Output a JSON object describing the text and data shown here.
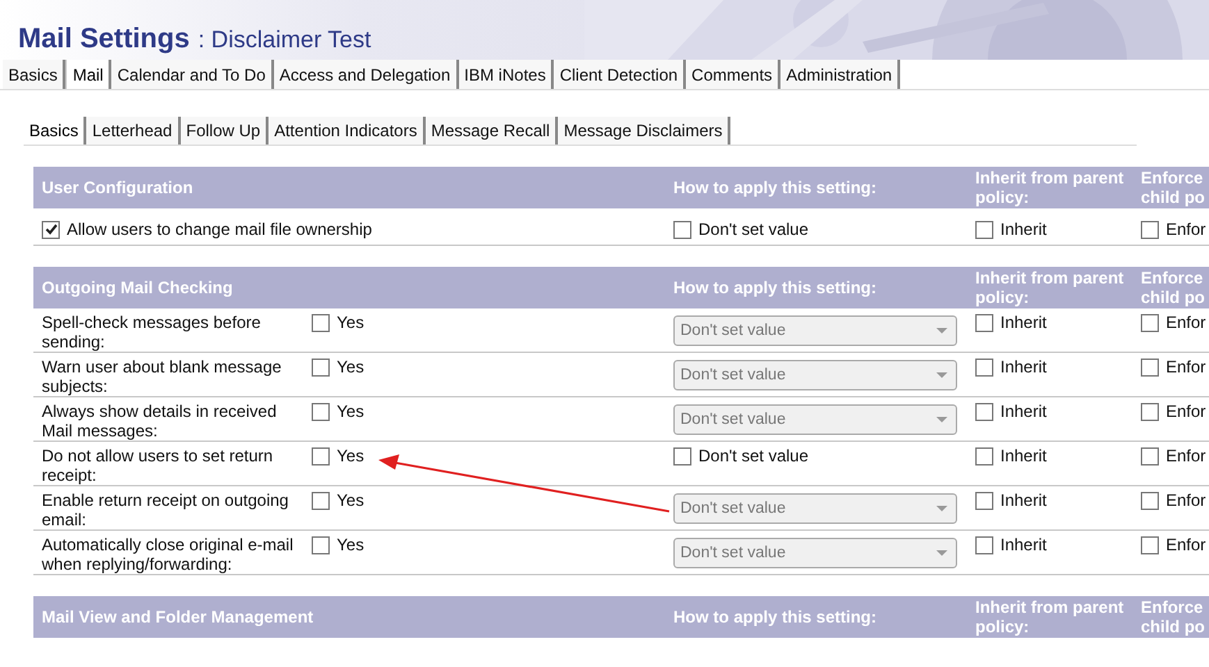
{
  "window": {
    "title": "Mail Settings",
    "subtitle": ": Disclaimer Test"
  },
  "tabs": [
    {
      "label": "Basics",
      "selected": false
    },
    {
      "label": "Mail",
      "selected": true
    },
    {
      "label": "Calendar and To Do",
      "selected": false
    },
    {
      "label": "Access and Delegation",
      "selected": false
    },
    {
      "label": "IBM iNotes",
      "selected": false
    },
    {
      "label": "Client Detection",
      "selected": false
    },
    {
      "label": "Comments",
      "selected": false
    },
    {
      "label": "Administration",
      "selected": false
    }
  ],
  "subtabs": [
    {
      "label": "Basics",
      "selected": true
    },
    {
      "label": "Letterhead",
      "selected": false
    },
    {
      "label": "Follow Up",
      "selected": false
    },
    {
      "label": "Attention Indicators",
      "selected": false
    },
    {
      "label": "Message Recall",
      "selected": false
    },
    {
      "label": "Message Disclaimers",
      "selected": false
    }
  ],
  "sections": [
    {
      "title": "User Configuration",
      "apply_header": "How to apply this setting:",
      "inherit_header": "Inherit from parent policy:",
      "enforce_header": "Enforce child po",
      "rows": [
        {
          "kind": "wide",
          "label": "Allow users to change mail file ownership",
          "checked": true,
          "apply": {
            "kind": "checkbox",
            "text": "Don't set value",
            "checked": false
          },
          "inherit": {
            "text": "Inherit",
            "checked": false
          },
          "enforce": {
            "text": "Enfor",
            "checked": false
          }
        }
      ]
    },
    {
      "title": "Outgoing Mail Checking",
      "apply_header": "How to apply this setting:",
      "inherit_header": "Inherit from parent policy:",
      "enforce_header": "Enforce child po",
      "rows": [
        {
          "kind": "yes",
          "label": "Spell-check messages before sending:",
          "value": "Yes",
          "checked": false,
          "apply": {
            "kind": "select",
            "text": "Don't set value",
            "disabled": true
          },
          "inherit": {
            "text": "Inherit",
            "checked": false
          },
          "enforce": {
            "text": "Enfor",
            "checked": false
          }
        },
        {
          "kind": "yes",
          "label": "Warn user about blank message subjects:",
          "value": "Yes",
          "checked": false,
          "apply": {
            "kind": "select",
            "text": "Don't set value",
            "disabled": true
          },
          "inherit": {
            "text": "Inherit",
            "checked": false
          },
          "enforce": {
            "text": "Enfor",
            "checked": false
          }
        },
        {
          "kind": "yes",
          "label": "Always show details in received Mail messages:",
          "value": "Yes",
          "checked": false,
          "apply": {
            "kind": "select",
            "text": "Don't set value",
            "disabled": true
          },
          "inherit": {
            "text": "Inherit",
            "checked": false
          },
          "enforce": {
            "text": "Enfor",
            "checked": false
          }
        },
        {
          "kind": "yes",
          "label": "Do not allow users to set return receipt:",
          "value": "Yes",
          "checked": false,
          "apply": {
            "kind": "checkbox",
            "text": "Don't set value",
            "checked": false
          },
          "inherit": {
            "text": "Inherit",
            "checked": false
          },
          "enforce": {
            "text": "Enfor",
            "checked": false
          }
        },
        {
          "kind": "yes",
          "label": "Enable return receipt on outgoing email:",
          "value": "Yes",
          "checked": false,
          "apply": {
            "kind": "select",
            "text": "Don't set value",
            "disabled": true
          },
          "inherit": {
            "text": "Inherit",
            "checked": false
          },
          "enforce": {
            "text": "Enfor",
            "checked": false
          }
        },
        {
          "kind": "yes",
          "label": "Automatically close original e-mail when replying/forwarding:",
          "value": "Yes",
          "checked": false,
          "apply": {
            "kind": "select",
            "text": "Don't set value",
            "disabled": true
          },
          "inherit": {
            "text": "Inherit",
            "checked": false
          },
          "enforce": {
            "text": "Enfor",
            "checked": false
          }
        }
      ]
    },
    {
      "title": "Mail View and Folder Management",
      "apply_header": "How to apply this setting:",
      "inherit_header": "Inherit from parent policy:",
      "enforce_header": "Enforce child po"
    }
  ],
  "annotation": {
    "kind": "arrow"
  }
}
